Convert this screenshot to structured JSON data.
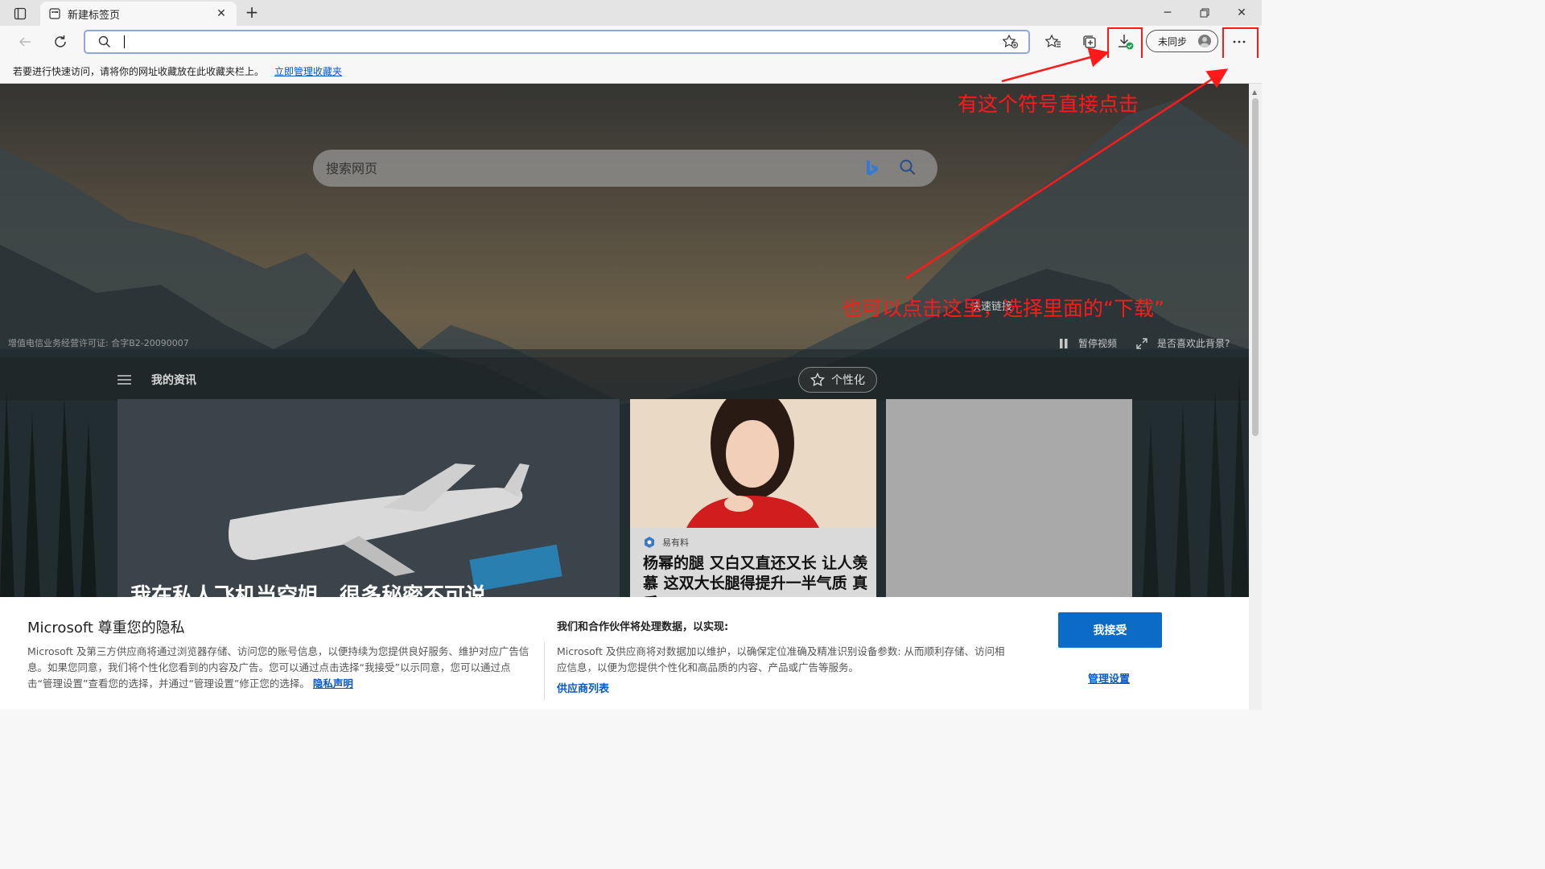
{
  "browser": {
    "tab_title": "新建标签页",
    "address_value": "",
    "sync_label": "未同步"
  },
  "favorites_bar": {
    "message": "若要进行快速访问，请将你的网址收藏放在此收藏夹栏上。",
    "link": "立即管理收藏夹"
  },
  "newtab": {
    "search_placeholder": "搜索网页",
    "license": "增值电信业务经营许可证: 合字B2-20090007",
    "quick_links": "快速链接",
    "pause_video": "暂停视频",
    "like_background": "是否喜欢此背景?",
    "my_news": "我的资讯",
    "personalize": "个性化"
  },
  "news": {
    "main_headline": "我在私人飞机当空姐，很多秘密不可说",
    "mid_source": "易有料",
    "mid_headline": "杨幂的腿 又白又直还又长 让人羡慕 这双大长腿得提升一半气质 真后"
  },
  "annotations": {
    "note1": "有这个符号直接点击",
    "note2": "也可以点击这里，选择里面的“下载”"
  },
  "privacy": {
    "title": "Microsoft 尊重您的隐私",
    "body": "Microsoft 及第三方供应商将通过浏览器存储、访问您的账号信息，以便持续为您提供良好服务、维护对应广告信息。如果您同意，我们将个性化您看到的内容及广告。您可以通过点击选择“我接受”以示同意，您可以通过点击“管理设置”查看您的选择，并通过“管理设置”修正您的选择。",
    "privacy_link": "隐私声明",
    "partners_title": "我们和合作伙伴将处理数据，以实现:",
    "partners_body": "Microsoft 及供应商将对数据加以维护，以确保定位准确及精准识别设备参数: 从而顺利存储、访问相应信息，以便为您提供个性化和高品质的内容、产品或广告等服务。",
    "vendor_list": "供应商列表",
    "accept": "我接受",
    "manage": "管理设置"
  },
  "colors": {
    "accent_blue": "#0b6bc7",
    "link_blue": "#0a58c8",
    "annotation_red": "#ff1a1a",
    "download_check": "#1aa34a"
  },
  "icons": [
    "tab-actions-icon",
    "newtab-page-icon",
    "close-icon",
    "plus-icon",
    "minimize-icon",
    "restore-icon",
    "window-close-icon",
    "back-icon",
    "refresh-icon",
    "search-icon",
    "add-favorite-icon",
    "favorites-icon",
    "collections-icon",
    "download-icon",
    "profile-icon",
    "more-icon",
    "bing-icon",
    "menu-icon",
    "personalize-icon",
    "pause-icon",
    "expand-icon"
  ]
}
